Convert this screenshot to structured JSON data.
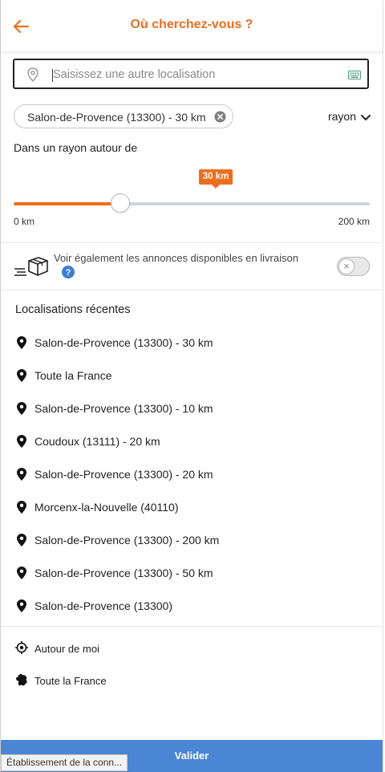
{
  "header": {
    "title": "Où cherchez-vous ?"
  },
  "search": {
    "placeholder": "Saisissez une autre localisation",
    "value": ""
  },
  "location_chip": {
    "label": "Salon-de-Provence (13300) - 30 km"
  },
  "mode_select": {
    "label": "rayon"
  },
  "radius": {
    "heading": "Dans un rayon autour de",
    "value_label": "30 km",
    "value": 30,
    "min": 0,
    "max": 200,
    "min_label": "0 km",
    "max_label": "200 km"
  },
  "delivery": {
    "text": "Voir également les annonces disponibles en livraison",
    "enabled": false
  },
  "recent": {
    "title": "Localisations récentes",
    "items": [
      "Salon-de-Provence (13300) - 30 km",
      "Toute la France",
      "Salon-de-Provence (13300) - 10 km",
      "Coudoux (13111) - 20 km",
      "Salon-de-Provence (13300) - 20 km",
      "Morcenx-la-Nouvelle (40110)",
      "Salon-de-Provence (13300) - 200 km",
      "Salon-de-Provence (13300) - 50 km",
      "Salon-de-Provence (13300)"
    ]
  },
  "options": {
    "around_me": "Autour de moi",
    "all_france": "Toute la France"
  },
  "footer": {
    "validate_label": "Valider"
  },
  "status": {
    "text": "Établissement de la conn..."
  },
  "colors": {
    "accent": "#ec6e1c",
    "button": "#4a86d4"
  }
}
